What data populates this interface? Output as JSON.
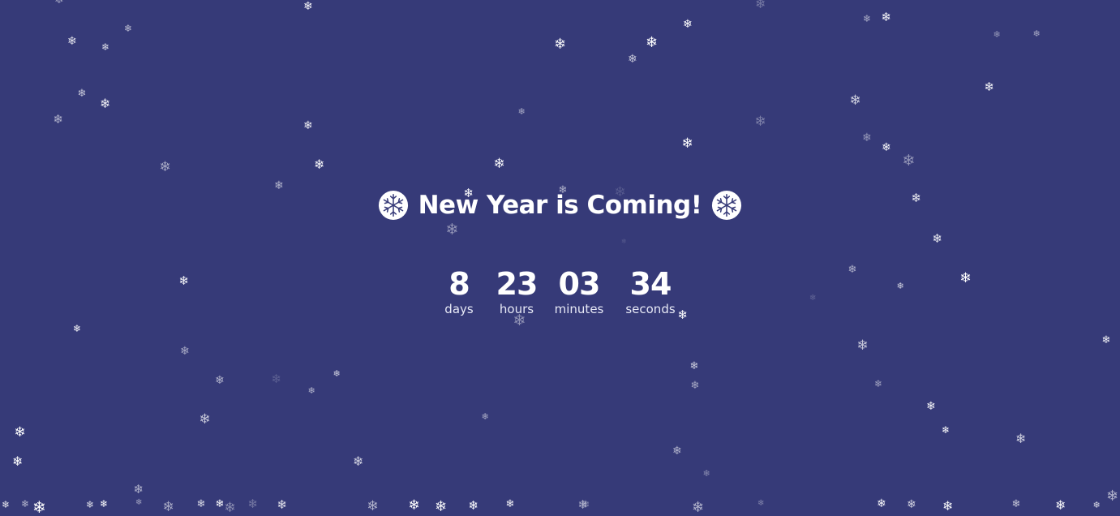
{
  "title": {
    "text": "New Year is Coming!",
    "icon": "snowflake-icon"
  },
  "countdown": [
    {
      "value": "8",
      "label": "days"
    },
    {
      "value": "23",
      "label": "hours"
    },
    {
      "value": "03",
      "label": "minutes"
    },
    {
      "value": "34",
      "label": "seconds"
    }
  ],
  "colors": {
    "background": "#363A78",
    "text": "#FFFFFF",
    "snowflake": "#FFFFFF"
  },
  "snowflake_glyph": "❄"
}
